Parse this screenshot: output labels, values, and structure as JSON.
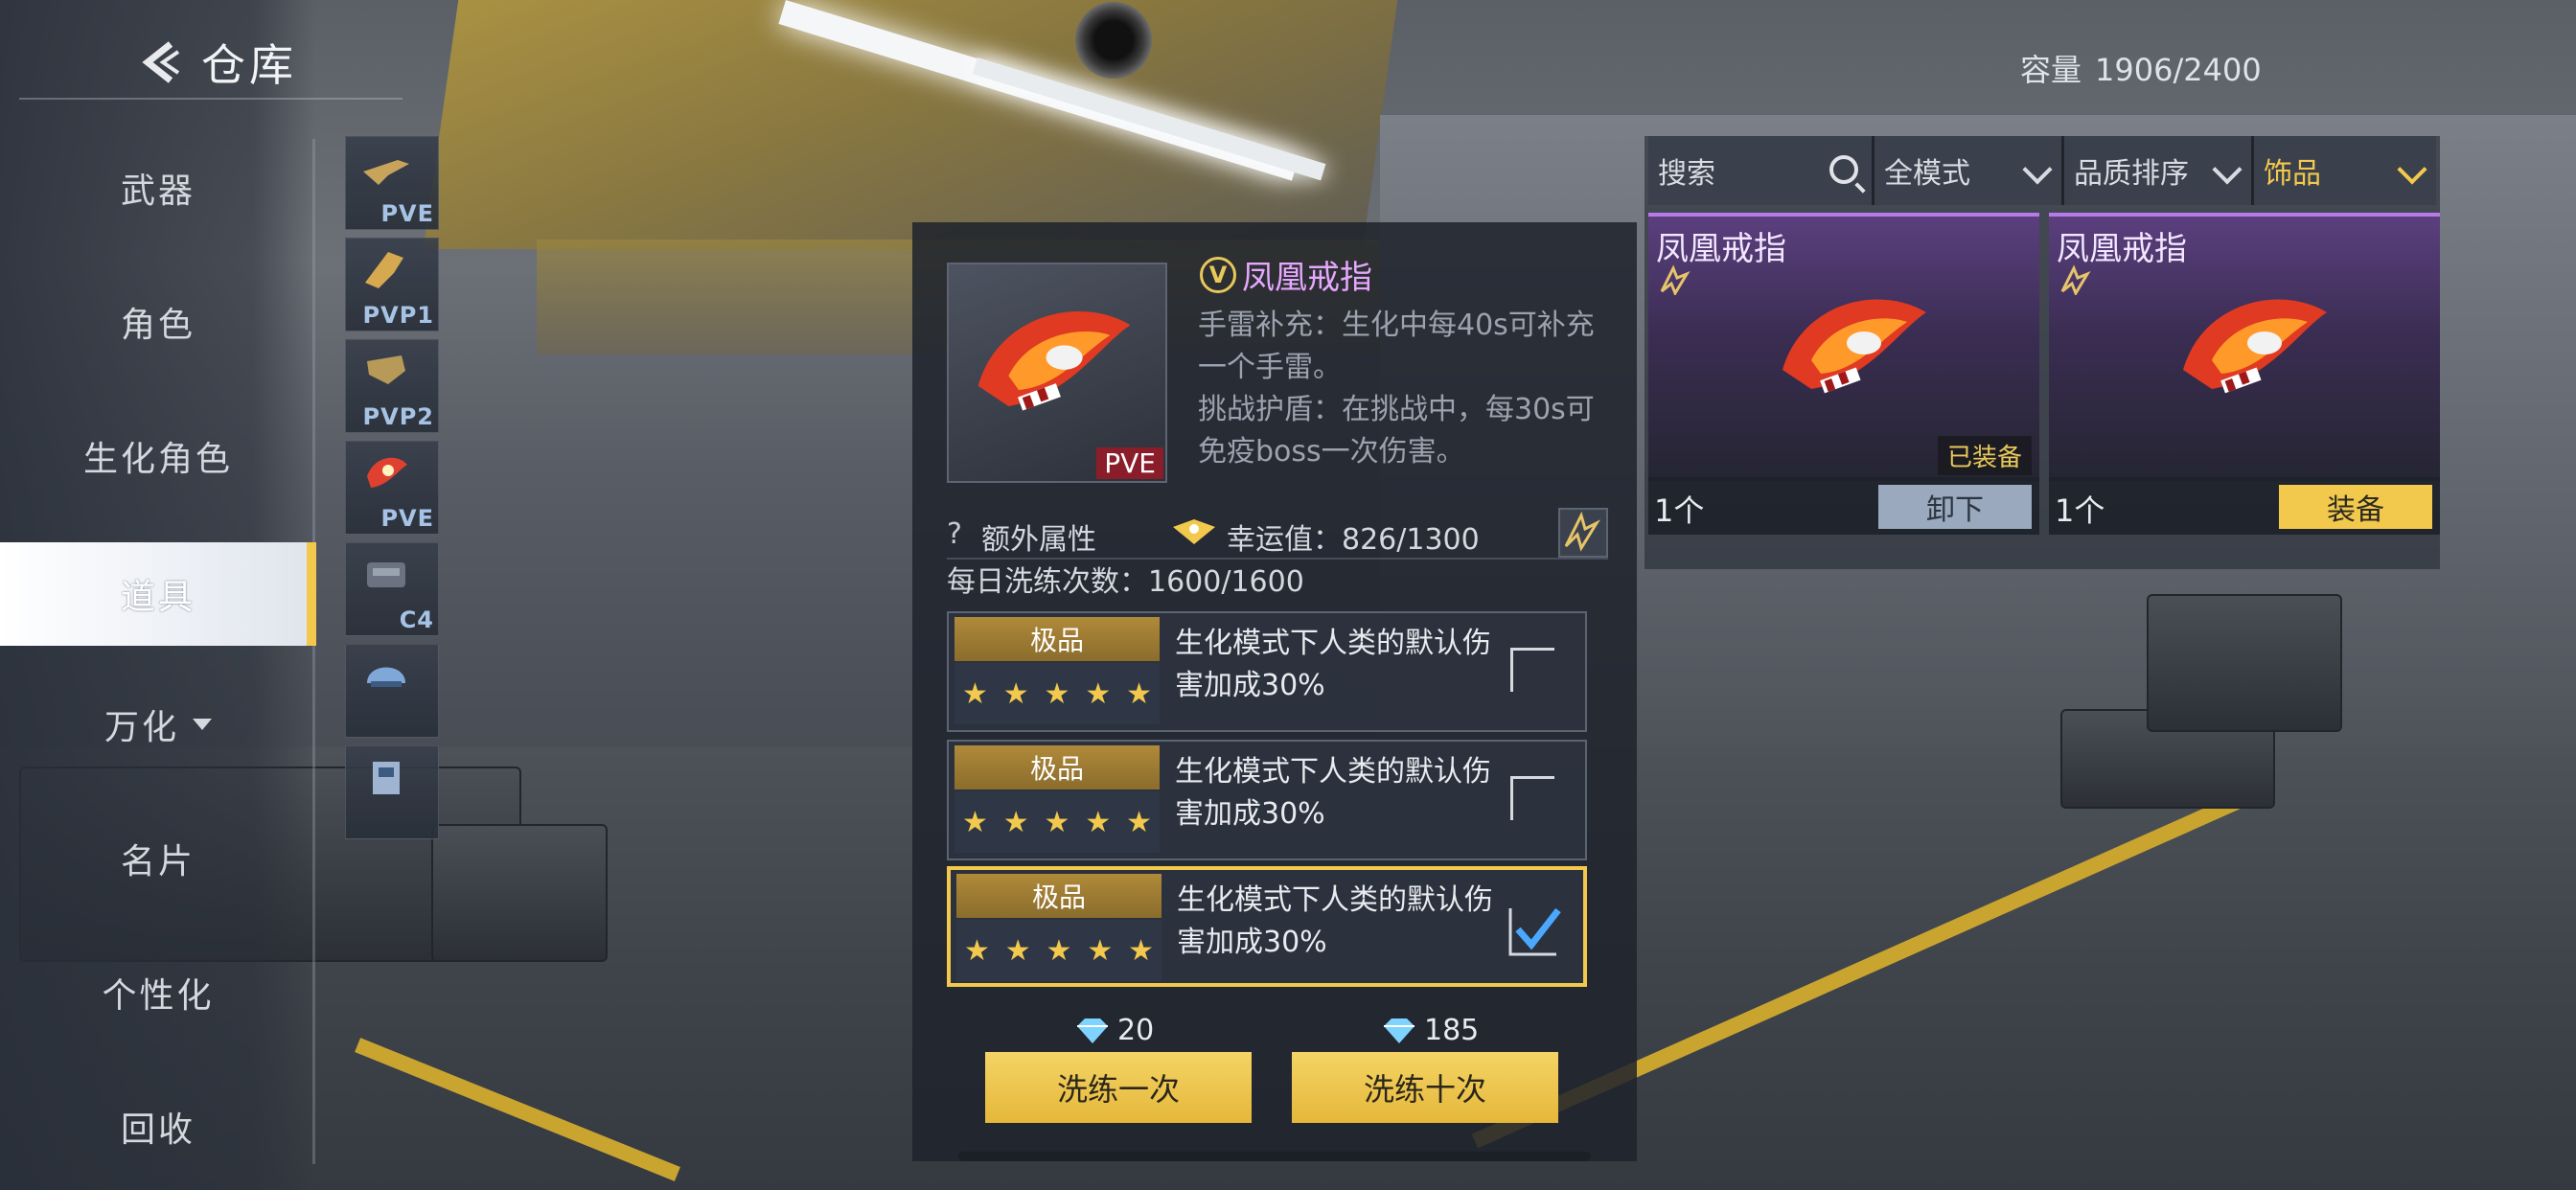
{
  "header": {
    "title": "仓库"
  },
  "capacity": {
    "label": "容量",
    "value": "1906/2400"
  },
  "nav": {
    "items": [
      {
        "label": "武器"
      },
      {
        "label": "角色"
      },
      {
        "label": "生化角色"
      },
      {
        "label": "道具"
      },
      {
        "label": "万化"
      },
      {
        "label": "名片"
      },
      {
        "label": "个性化"
      },
      {
        "label": "回收"
      }
    ],
    "active": "道具"
  },
  "subnav": {
    "items": [
      {
        "tag": "PVE"
      },
      {
        "tag": "PVP1"
      },
      {
        "tag": "PVP2"
      },
      {
        "tag": "PVE"
      },
      {
        "tag": "C4"
      },
      {
        "tag": ""
      },
      {
        "tag": ""
      }
    ]
  },
  "filters": {
    "search_placeholder": "搜索",
    "mode": "全模式",
    "sort": "品质排序",
    "category": "饰品"
  },
  "inventory": [
    {
      "name": "凤凰戒指",
      "count": "1个",
      "status": "已装备",
      "action": "卸下"
    },
    {
      "name": "凤凰戒指",
      "count": "1个",
      "status": "",
      "action": "装备"
    }
  ],
  "detail": {
    "badge": "V",
    "name": "凤凰戒指",
    "mode_tag": "PVE",
    "desc1": "手雷补充：生化中每40s可补充一个手雷。",
    "desc2": "挑战护盾：在挑战中，每30s可免疫boss一次伤害。",
    "extra_attr_label": "额外属性",
    "luck_label": "幸运值：",
    "luck_value": "826/1300",
    "daily_label": "每日洗练次数：",
    "daily_value": "1600/1600"
  },
  "options": [
    {
      "grade": "极品",
      "stars": 5,
      "text": "生化模式下人类的默认伤害加成30%",
      "checked": false
    },
    {
      "grade": "极品",
      "stars": 5,
      "text": "生化模式下人类的默认伤害加成30%",
      "checked": false
    },
    {
      "grade": "极品",
      "stars": 5,
      "text": "生化模式下人类的默认伤害加成30%",
      "checked": true
    }
  ],
  "refine": {
    "once": {
      "label": "洗练一次",
      "cost": "20"
    },
    "ten": {
      "label": "洗练十次",
      "cost": "185"
    }
  },
  "colors": {
    "accent": "#f2c94c",
    "purple": "#b77ae6",
    "item_name": "#e6a8ff"
  }
}
